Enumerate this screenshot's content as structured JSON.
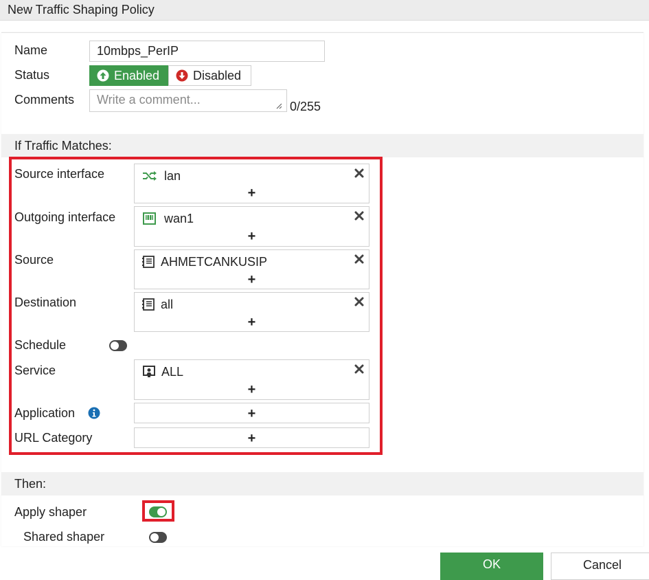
{
  "window": {
    "title": "New Traffic Shaping Policy"
  },
  "colors": {
    "accent_green": "#3e9a4c",
    "highlight_red": "#e01f2b",
    "info_blue": "#1a6fb3"
  },
  "form": {
    "name": {
      "label": "Name",
      "value": "10mbps_PerIP"
    },
    "status": {
      "label": "Status",
      "enabled_label": "Enabled",
      "disabled_label": "Disabled",
      "selected": "Enabled"
    },
    "comments": {
      "label": "Comments",
      "placeholder": "Write a comment...",
      "counter": "0/255"
    }
  },
  "match_section": {
    "title": "If Traffic Matches:",
    "source_interface": {
      "label": "Source interface",
      "item": "lan",
      "icon": "interface-shuffle-icon"
    },
    "outgoing_interface": {
      "label": "Outgoing interface",
      "item": "wan1",
      "icon": "wan-port-icon"
    },
    "source": {
      "label": "Source",
      "item": "AHMETCANKUSIP",
      "icon": "address-icon"
    },
    "destination": {
      "label": "Destination",
      "item": "all",
      "icon": "address-icon"
    },
    "schedule": {
      "label": "Schedule",
      "enabled": false
    },
    "service": {
      "label": "Service",
      "item": "ALL",
      "icon": "service-icon"
    },
    "application": {
      "label": "Application"
    },
    "url_category": {
      "label": "URL Category"
    },
    "add_symbol": "+"
  },
  "then_section": {
    "title": "Then:",
    "apply_shaper": {
      "label": "Apply shaper",
      "enabled": true
    },
    "shared_shaper": {
      "label": "Shared shaper",
      "enabled": false
    }
  },
  "buttons": {
    "ok": "OK",
    "cancel": "Cancel"
  }
}
